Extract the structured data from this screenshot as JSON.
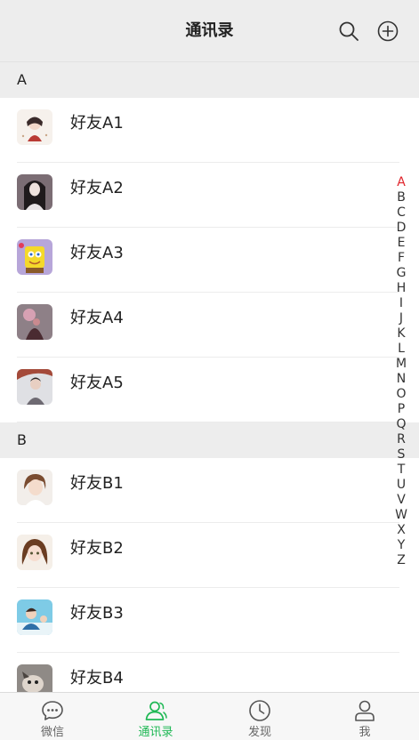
{
  "header": {
    "title": "通讯录",
    "search_icon": "search-icon",
    "add_icon": "add-circle-icon"
  },
  "sections": [
    {
      "letter": "A",
      "contacts": [
        {
          "name": "好友A1"
        },
        {
          "name": "好友A2"
        },
        {
          "name": "好友A3"
        },
        {
          "name": "好友A4"
        },
        {
          "name": "好友A5"
        }
      ]
    },
    {
      "letter": "B",
      "contacts": [
        {
          "name": "好友B1"
        },
        {
          "name": "好友B2"
        },
        {
          "name": "好友B3"
        },
        {
          "name": "好友B4"
        }
      ]
    }
  ],
  "index": {
    "letters": [
      "A",
      "B",
      "C",
      "D",
      "E",
      "F",
      "G",
      "H",
      "I",
      "J",
      "K",
      "L",
      "M",
      "N",
      "O",
      "P",
      "Q",
      "R",
      "S",
      "T",
      "U",
      "V",
      "W",
      "X",
      "Y",
      "Z"
    ],
    "active": "A"
  },
  "tabs": [
    {
      "label": "微信",
      "icon": "chat-bubble-icon",
      "active": false
    },
    {
      "label": "通讯录",
      "icon": "contacts-icon",
      "active": true
    },
    {
      "label": "发现",
      "icon": "clock-icon",
      "active": false
    },
    {
      "label": "我",
      "icon": "person-icon",
      "active": false
    }
  ],
  "colors": {
    "accent": "#1fb855",
    "index_active": "#e0242b",
    "header_bg": "#ededed"
  }
}
